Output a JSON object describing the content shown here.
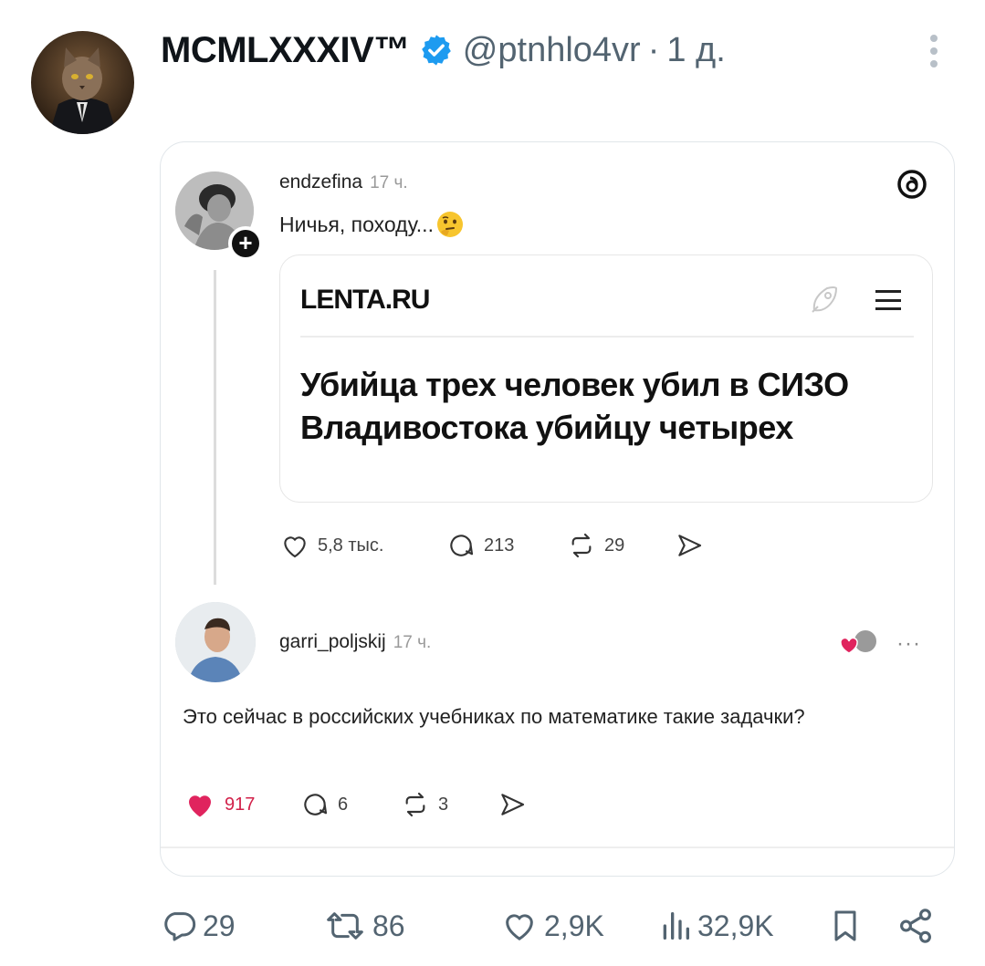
{
  "tweet": {
    "display_name": "MCMLXXXIV™",
    "handle": "@ptnhlo4vr",
    "separator": "·",
    "time": "1 д."
  },
  "embedded": {
    "post": {
      "username": "endzefina",
      "time": "17 ч.",
      "text": "Ничья, походу..."
    },
    "news": {
      "source": "LENTA.RU",
      "headline": "Убийца трех человек убил в СИЗО Владивостока убийцу четырех"
    },
    "post_actions": {
      "likes": "5,8 тыс.",
      "replies": "213",
      "reposts": "29"
    },
    "reply": {
      "username": "garri_poljskij",
      "time": "17 ч.",
      "text": "Это сейчас в российских учебниках по математике такие задачки?",
      "likes": "917",
      "replies": "6",
      "reposts": "3"
    }
  },
  "stats": {
    "replies": "29",
    "retweets": "86",
    "likes": "2,9K",
    "views": "32,9K"
  },
  "colors": {
    "verified": "#1d9bf0",
    "text_primary": "#0f1419",
    "text_secondary": "#536471",
    "like_red": "#d2214a"
  }
}
